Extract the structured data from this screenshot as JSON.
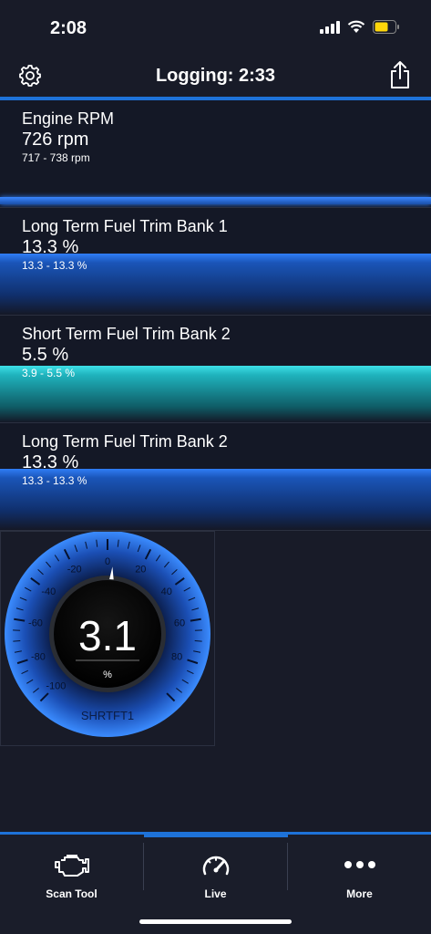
{
  "status_bar": {
    "time": "2:08"
  },
  "header": {
    "title": "Logging:  2:33"
  },
  "tiles": [
    {
      "label": "Engine RPM",
      "value": "726 rpm",
      "range": "717 - 738 rpm",
      "level": 0.02
    },
    {
      "label": "Long Term Fuel Trim Bank 1",
      "value": "13.3 %",
      "range": "13.3 - 13.3 %",
      "level": 0.57
    },
    {
      "label": "Short Term Fuel Trim Bank 2",
      "value": "5.5 %",
      "range": "3.9 - 5.5 %",
      "level": 0.53
    },
    {
      "label": "Long Term Fuel Trim Bank 2",
      "value": "13.3 %",
      "range": "13.3 - 13.3 %",
      "level": 0.57
    }
  ],
  "gauge": {
    "value": "3.1",
    "unit": "%",
    "name": "SHRTFT1",
    "needle_value": 3.1,
    "min": -100,
    "max": 100,
    "tick_labels": [
      "-100",
      "-80",
      "-60",
      "-40",
      "-20",
      "0",
      "20",
      "40",
      "60",
      "80"
    ]
  },
  "bottom_nav": {
    "items": [
      {
        "label": "Scan Tool",
        "icon": "engine-icon"
      },
      {
        "label": "Live",
        "icon": "speedometer-icon"
      },
      {
        "label": "More",
        "icon": "ellipsis-icon"
      }
    ],
    "selected": "Live"
  },
  "colors": {
    "accent": "#1e72d8",
    "bar_blue": "#2f7df6",
    "bar_cyan": "#3ee0e8",
    "background": "#181b28"
  }
}
